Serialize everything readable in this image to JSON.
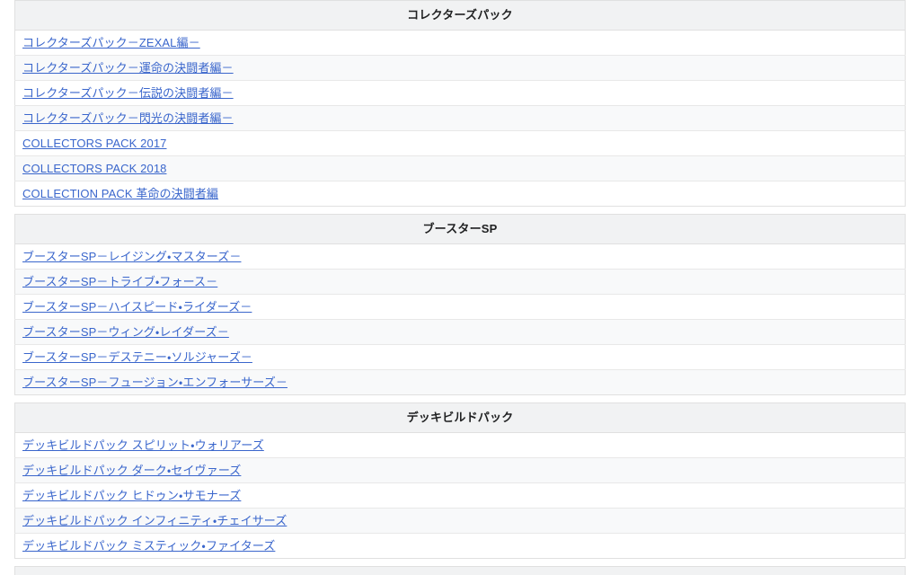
{
  "page": {
    "background_color": "#ffffff",
    "link_color": "#3a66cc",
    "header_background": "#f1f2f3",
    "alt_row_background": "#f8f9fa",
    "border_color": "#e0e0e0"
  },
  "sections": [
    {
      "heading": "コレクターズパック",
      "items": [
        "コレクターズパック－ZEXAL編－",
        "コレクターズパック－運命の決闘者編－",
        "コレクターズパック－伝説の決闘者編－",
        "コレクターズパック－閃光の決闘者編－",
        "COLLECTORS PACK 2017",
        "COLLECTORS PACK 2018",
        "COLLECTION PACK 革命の決闘者編"
      ]
    },
    {
      "heading": "ブースターSP",
      "items": [
        "ブースターSP－レイジング・マスターズ－",
        "ブースターSP－トライブ・フォース－",
        "ブースターSP－ハイスピード・ライダーズ－",
        "ブースターSP－ウィング・レイダーズ－",
        "ブースターSP－デステニー・ソルジャーズ－",
        "ブースターSP－フュージョン・エンフォーサーズ－"
      ]
    },
    {
      "heading": "デッキビルドパック",
      "items": [
        "デッキビルドパック スピリット・ウォリアーズ",
        "デッキビルドパック ダーク・セイヴァーズ",
        "デッキビルドパック ヒドゥン・サモナーズ",
        "デッキビルドパック インフィニティ・チェイサーズ",
        "デッキビルドパック ミスティック・ファイターズ"
      ]
    }
  ]
}
